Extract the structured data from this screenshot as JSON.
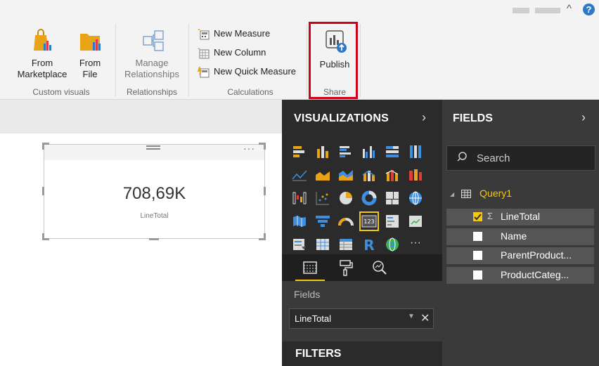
{
  "ribbon": {
    "custom_visuals": {
      "marketplace_label_1": "From",
      "marketplace_label_2": "Marketplace",
      "file_label_1": "From",
      "file_label_2": "File",
      "group_label": "Custom visuals"
    },
    "relationships": {
      "manage_label_1": "Manage",
      "manage_label_2": "Relationships",
      "group_label": "Relationships"
    },
    "calculations": {
      "new_measure": "New Measure",
      "new_column": "New Column",
      "new_quick_measure": "New Quick Measure",
      "group_label": "Calculations"
    },
    "share": {
      "publish_label": "Publish",
      "group_label": "Share"
    }
  },
  "window": {
    "help_icon": "?",
    "collapse_icon": "^"
  },
  "card_visual": {
    "value": "708,69K",
    "label": "LineTotal",
    "more_icon": "···"
  },
  "visualizations": {
    "title": "VISUALIZATIONS",
    "chevron": "›",
    "fields_well_label": "Fields",
    "field_value": "LineTotal",
    "remove_icon": "✕",
    "dropdown_icon": "▼",
    "filters_title": "FILTERS",
    "more_visuals": "···"
  },
  "fields_pane": {
    "title": "FIELDS",
    "chevron": "›",
    "search_placeholder": "Search",
    "table_name": "Query1",
    "items": [
      {
        "name": "LineTotal",
        "checked": true,
        "sigma": "Σ"
      },
      {
        "name": "Name",
        "checked": false
      },
      {
        "name": "ParentProduct...",
        "checked": false
      },
      {
        "name": "ProductCateg...",
        "checked": false
      }
    ]
  },
  "colors": {
    "accent_yellow": "#f2c811",
    "highlight_red": "#d0021b",
    "panel_dark": "#2b2b2b",
    "panel_mid": "#3a3a3a"
  }
}
